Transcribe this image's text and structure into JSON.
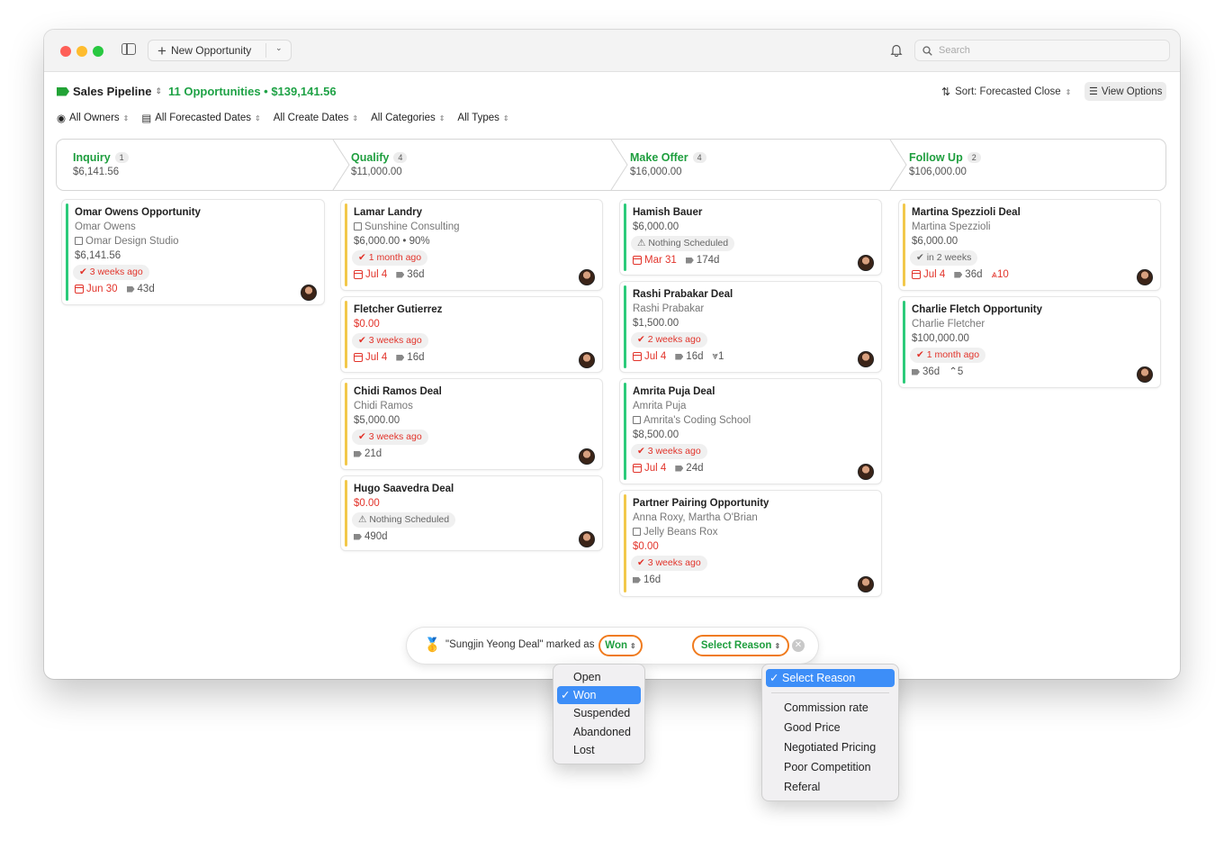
{
  "toolbar": {
    "new_label": "New Opportunity",
    "search_placeholder": "Search"
  },
  "header": {
    "title": "Sales Pipeline",
    "count": "11 Opportunities • $139,141.56",
    "sort": "Sort: Forecasted Close",
    "view_options": "View Options"
  },
  "filters": [
    "All Owners",
    "All Forecasted Dates",
    "All Create Dates",
    "All Categories",
    "All Types"
  ],
  "stages": [
    {
      "name": "Inquiry",
      "count": "1",
      "amount": "$6,141.56"
    },
    {
      "name": "Qualify",
      "count": "4",
      "amount": "$11,000.00"
    },
    {
      "name": "Make Offer",
      "count": "4",
      "amount": "$16,000.00"
    },
    {
      "name": "Follow Up",
      "count": "2",
      "amount": "$106,000.00"
    }
  ],
  "cards": {
    "c1": {
      "title": "Omar Owens Opportunity",
      "contact": "Omar Owens",
      "company": "Omar Design Studio",
      "amount": "$6,141.56",
      "activity": "3 weeks ago",
      "date": "Jun 30",
      "days": "43d"
    },
    "c2": {
      "title": "Lamar Landry",
      "company": "Sunshine Consulting",
      "amount": "$6,000.00 • 90%",
      "activity": "1 month ago",
      "date": "Jul 4",
      "days": "36d"
    },
    "c3": {
      "title": "Fletcher Gutierrez",
      "amount": "$0.00",
      "activity": "3 weeks ago",
      "date": "Jul 4",
      "days": "16d"
    },
    "c4": {
      "title": "Chidi Ramos Deal",
      "contact": "Chidi Ramos",
      "amount": "$5,000.00",
      "activity": "3 weeks ago",
      "days": "21d"
    },
    "c5": {
      "title": "Hugo Saavedra Deal",
      "amount": "$0.00",
      "activity": "Nothing Scheduled",
      "days": "490d"
    },
    "c6": {
      "title": "Hamish Bauer",
      "amount": "$6,000.00",
      "activity": "Nothing Scheduled",
      "date": "Mar 31",
      "days": "174d"
    },
    "c7": {
      "title": "Rashi Prabakar Deal",
      "contact": "Rashi Prabakar",
      "amount": "$1,500.00",
      "activity": "2 weeks ago",
      "date": "Jul 4",
      "days": "16d",
      "extra": "1"
    },
    "c8": {
      "title": "Amrita Puja Deal",
      "contact": "Amrita Puja",
      "company": "Amrita's Coding School",
      "amount": "$8,500.00",
      "activity": "3 weeks ago",
      "date": "Jul 4",
      "days": "24d"
    },
    "c9": {
      "title": "Partner Pairing Opportunity",
      "contact": "Anna Roxy, Martha O'Brian",
      "company": "Jelly Beans Rox",
      "amount": "$0.00",
      "activity": "3 weeks ago",
      "days": "16d"
    },
    "c10": {
      "title": "Martina Spezzioli Deal",
      "contact": "Martina Spezzioli",
      "amount": "$6,000.00",
      "activity": "in 2 weeks",
      "date": "Jul 4",
      "days": "36d",
      "extra": "10"
    },
    "c11": {
      "title": "Charlie Fletch Opportunity",
      "contact": "Charlie Fletcher",
      "amount": "$100,000.00",
      "activity": "1 month ago",
      "days": "36d",
      "extra": "5"
    }
  },
  "toast": {
    "message": "\"Sungjin Yeong Deal\" marked as",
    "status": "Won",
    "reason": "Select Reason"
  },
  "status_menu": [
    "Open",
    "Won",
    "Suspended",
    "Abandoned",
    "Lost"
  ],
  "reason_menu": {
    "selected": "Select Reason",
    "items": [
      "Commission rate",
      "Good Price",
      "Negotiated Pricing",
      "Poor Competition",
      "Referal"
    ]
  },
  "colors": {
    "accent": "#1e9e3e",
    "danger": "#e2342b",
    "highlight": "#f07b1e",
    "selection": "#3d8ef8"
  }
}
